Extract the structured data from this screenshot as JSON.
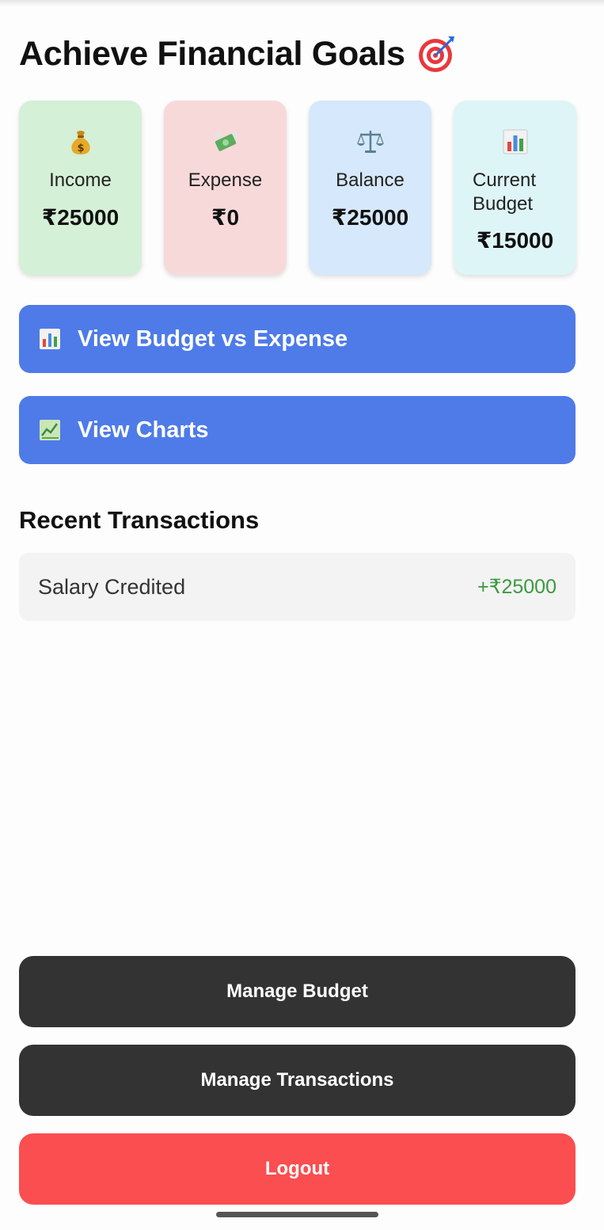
{
  "header": {
    "title": "Achieve Financial Goals",
    "title_icon": "target-icon"
  },
  "cards": {
    "income": {
      "label": "Income",
      "value": "₹25000",
      "icon": "money-bag-icon"
    },
    "expense": {
      "label": "Expense",
      "value": "₹0",
      "icon": "money-wings-icon"
    },
    "balance": {
      "label": "Balance",
      "value": "₹25000",
      "icon": "scales-icon"
    },
    "budget": {
      "label_line1": "Current",
      "label_line2": "Budget",
      "value": "₹15000",
      "icon": "bar-chart-icon"
    }
  },
  "actions": {
    "budget_vs_expense": {
      "label": "View Budget vs Expense",
      "icon": "bar-chart-icon"
    },
    "charts": {
      "label": "View Charts",
      "icon": "chart-up-icon"
    }
  },
  "recent": {
    "title": "Recent Transactions",
    "items": [
      {
        "description": "Salary Credited",
        "amount": "+₹25000"
      }
    ]
  },
  "footer": {
    "manage_budget": "Manage Budget",
    "manage_transactions": "Manage Transactions",
    "logout": "Logout"
  },
  "colors": {
    "income_bg": "#d4f0d6",
    "expense_bg": "#f8d9da",
    "balance_bg": "#d6e8fb",
    "budget_bg": "#def5f8",
    "primary": "#4e7be8",
    "dark": "#333333",
    "danger": "#fa4e50",
    "positive": "#3a9a3c"
  }
}
